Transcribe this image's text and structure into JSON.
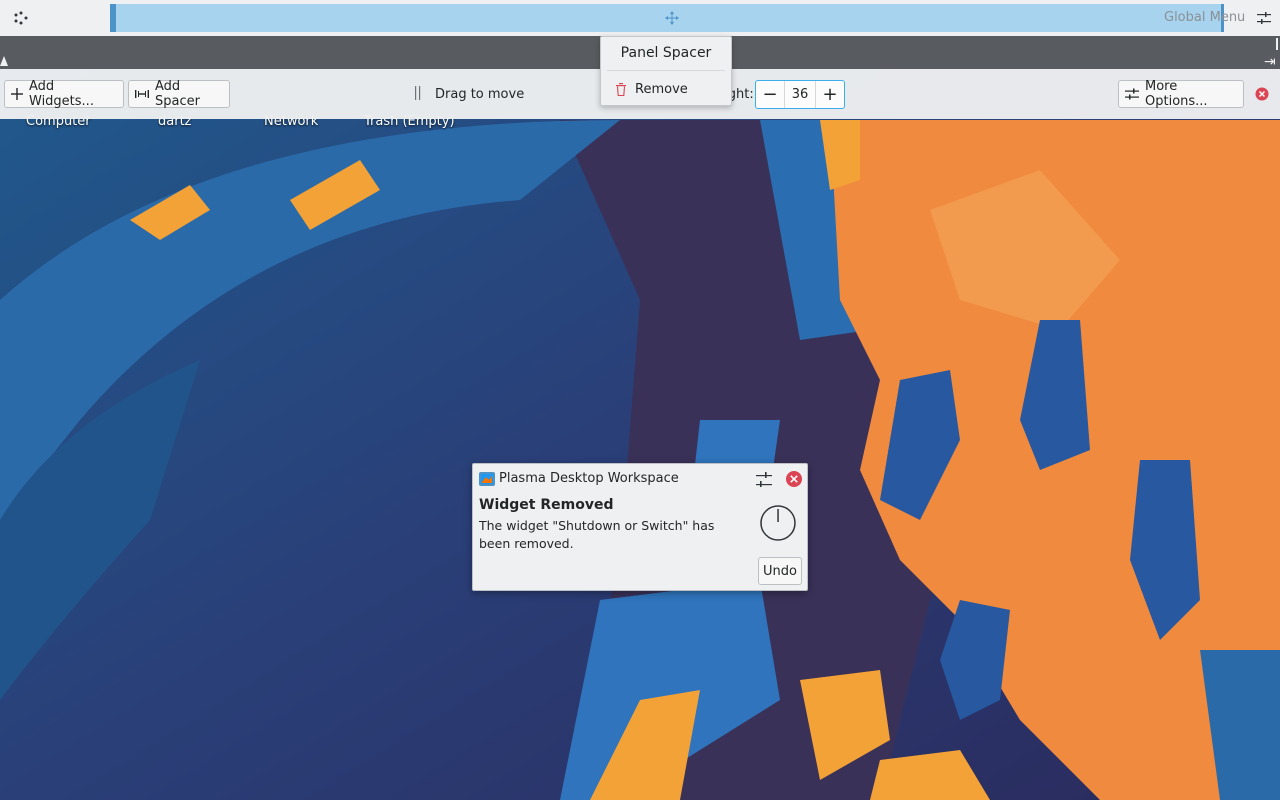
{
  "top_panel": {
    "global_menu_label": "Global Menu"
  },
  "toolbar": {
    "add_widgets_label": "Add Widgets...",
    "add_spacer_label": "Add Spacer",
    "drag_label": "Drag to move",
    "height_label": "anel height:",
    "height_value": "36",
    "more_options_label": "More Options..."
  },
  "context_menu": {
    "title": "Panel Spacer",
    "remove_label": "Remove"
  },
  "desktop_icons": [
    {
      "label": "Computer"
    },
    {
      "label": "dartz"
    },
    {
      "label": "Network"
    },
    {
      "label": "Trash (Empty)"
    }
  ],
  "notification": {
    "app_name": "Plasma Desktop Workspace",
    "title": "Widget Removed",
    "body": "The widget \"Shutdown or Switch\" has been removed.",
    "undo_label": "Undo"
  },
  "colors": {
    "accent": "#3daee9",
    "spacer_highlight": "#a7d3ee",
    "close_red": "#da4453",
    "panel_bg": "#eff0f1"
  }
}
